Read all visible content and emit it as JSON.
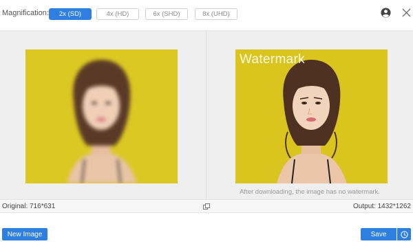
{
  "toolbar": {
    "magnification_label": "Magnification:",
    "options": [
      "2x (SD)",
      "4x (HD)",
      "6x (SHD)",
      "8x (UHD)"
    ],
    "selected": "2x (SD)"
  },
  "preview": {
    "watermark_text": "Watermark",
    "watermark_note": "After downloading, the image has no watermark."
  },
  "status": {
    "original": "Original: 716*631",
    "output": "Output: 1432*1262"
  },
  "actions": {
    "new_image": "New Image",
    "save": "Save"
  },
  "icons": {
    "account": "user-circle-icon",
    "close": "close-icon",
    "compare": "compare-icon",
    "history": "clock-icon"
  },
  "colors": {
    "accent": "#2f7fe0",
    "photo_background": "#d9c51d"
  }
}
